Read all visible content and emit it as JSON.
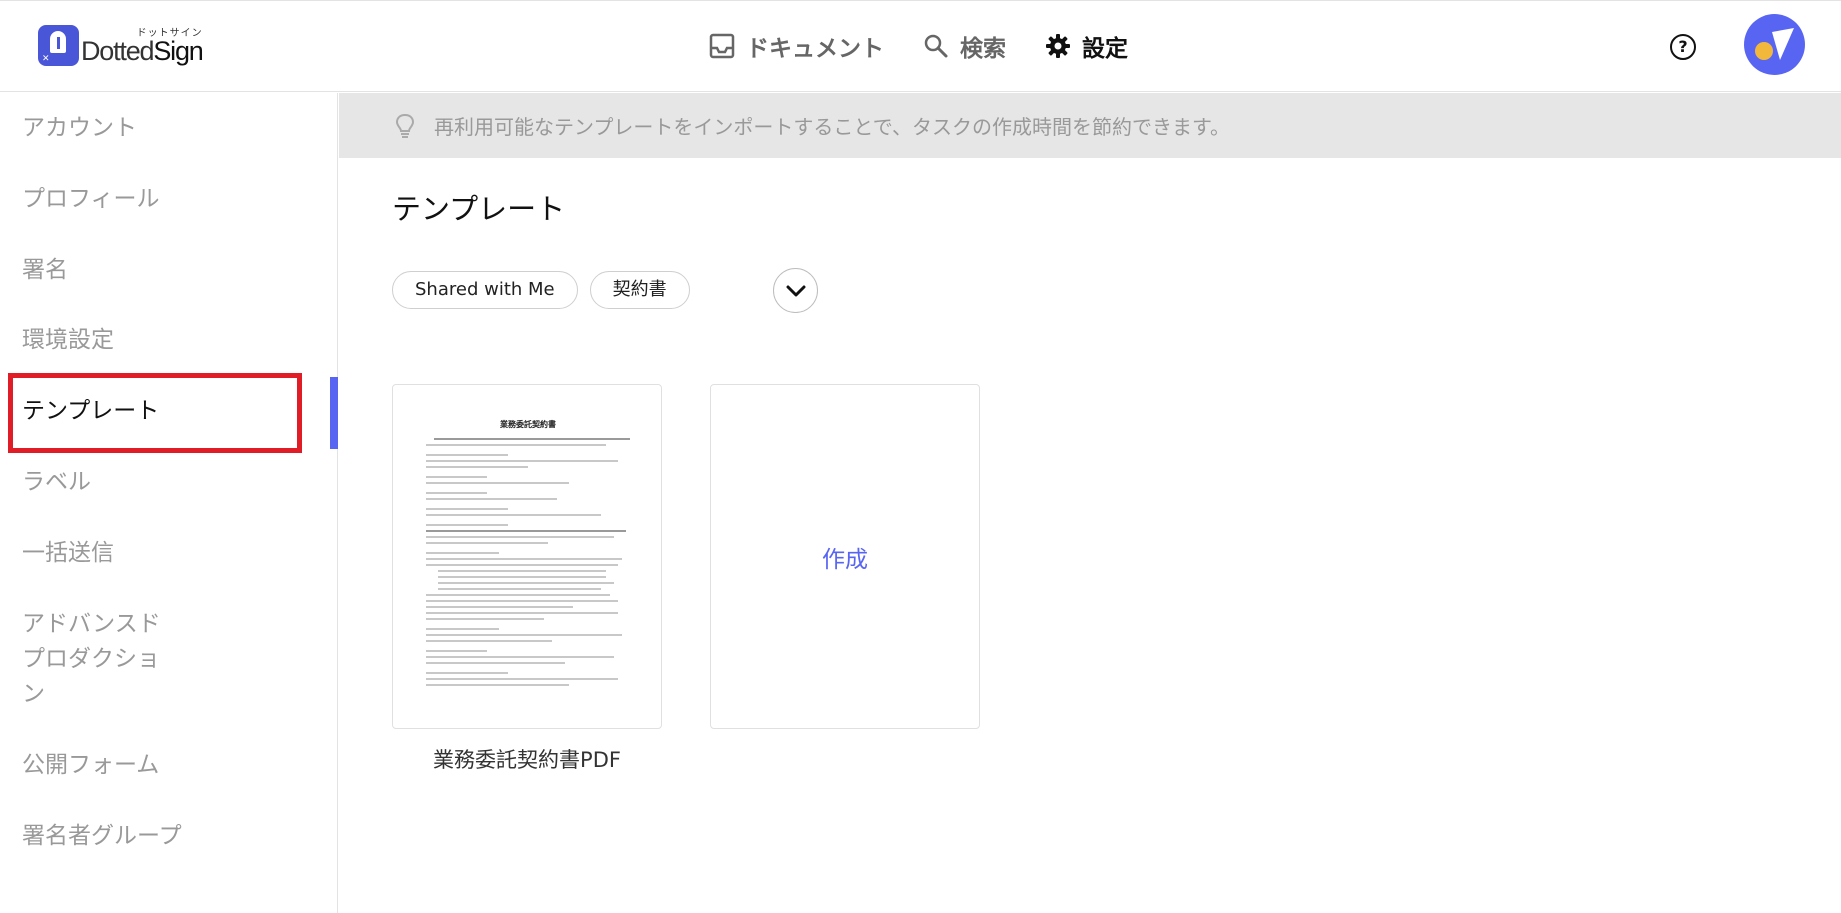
{
  "app": {
    "logo_sub": "ドットサイン",
    "logo_name_a": "Dotted",
    "logo_name_b": "Sign"
  },
  "nav": {
    "documents": "ドキュメント",
    "search": "検索",
    "settings": "設定"
  },
  "header": {
    "help": "?"
  },
  "sidebar": {
    "items": [
      {
        "label": "アカウント"
      },
      {
        "label": "プロフィール"
      },
      {
        "label": "署名"
      },
      {
        "label": "環境設定"
      },
      {
        "label": "テンプレート"
      },
      {
        "label": "ラベル"
      },
      {
        "label": "一括送信"
      },
      {
        "label": "アドバンスド\nプロダクショ\nン"
      },
      {
        "label": "公開フォーム"
      },
      {
        "label": "署名者グループ"
      }
    ]
  },
  "banner": {
    "text": "再利用可能なテンプレートをインポートすることで、タスクの作成時間を節約できます。"
  },
  "main": {
    "title": "テンプレート",
    "filters": [
      "Shared with Me",
      "契約書"
    ],
    "cards": {
      "template_name": "業務委託契約書PDF",
      "thumb_title": "業務委託契約書",
      "create_label": "作成"
    }
  },
  "colors": {
    "accent": "#5865f2",
    "highlight": "#e01c26"
  }
}
